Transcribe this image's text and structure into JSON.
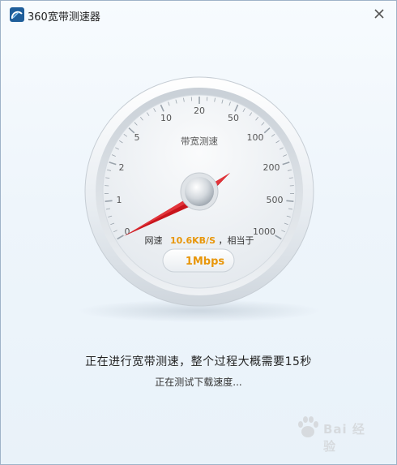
{
  "window": {
    "title": "360宽带测速器"
  },
  "gauge": {
    "title": "带宽测速",
    "scale_labels": [
      "0",
      "1",
      "2",
      "5",
      "10",
      "20",
      "50",
      "100",
      "200",
      "500",
      "1000"
    ],
    "speed_label": "网速",
    "speed_value": "10.6KB/S",
    "equivalent_label": "，相当于",
    "mbps": "1Mbps",
    "needle_scale_value": "100-200",
    "accent_color": "#e8960a",
    "needle_color": "#c8141c"
  },
  "status": {
    "main": "正在进行宽带测速，整个过程大概需要15秒",
    "sub": "正在测试下载速度..."
  },
  "watermark": {
    "text": "Bai 经验"
  }
}
